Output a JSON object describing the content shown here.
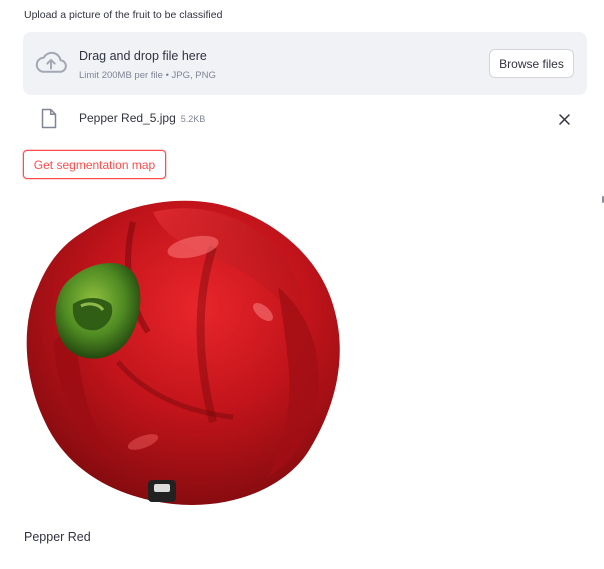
{
  "uploader": {
    "label": "Upload a picture of the fruit to be classified",
    "dropzone_title": "Drag and drop file here",
    "dropzone_limit": "Limit 200MB per file • JPG, PNG",
    "browse_label": "Browse files"
  },
  "file": {
    "name": "Pepper Red_5.jpg",
    "size": "5.2KB"
  },
  "actions": {
    "segmentation_label": "Get segmentation map"
  },
  "result": {
    "caption": "Pepper Red"
  },
  "icons": {
    "upload": "cloud-upload-icon",
    "file": "file-icon",
    "close": "close-icon"
  },
  "colors": {
    "accent": "#ff4b4b",
    "dropzone_bg": "#f0f2f6",
    "text": "#31333f",
    "muted": "#808495"
  }
}
